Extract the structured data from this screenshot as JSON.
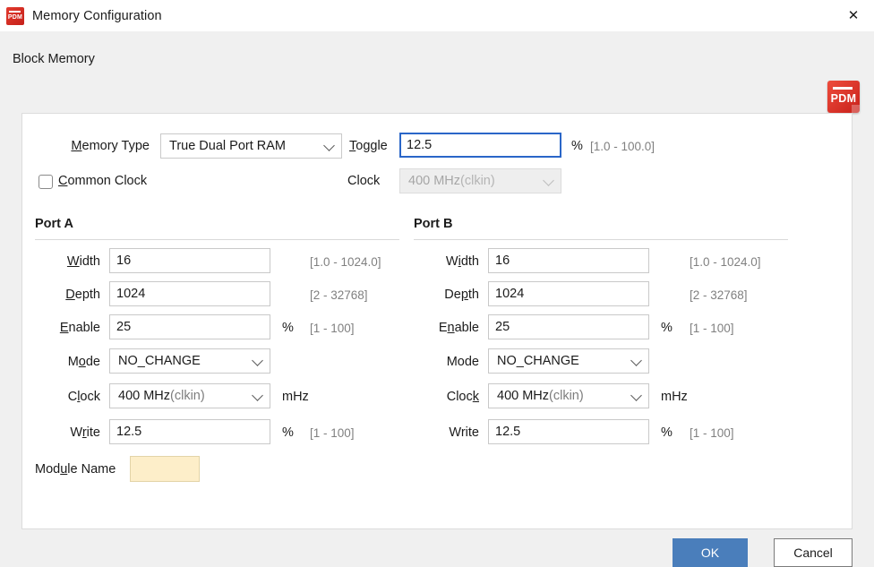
{
  "titlebar": {
    "title": "Memory Configuration",
    "icon_label": "PDM",
    "close_label": "✕"
  },
  "header": {
    "section_title": "Block Memory",
    "logo_label": "PDM"
  },
  "top_form": {
    "memory_type": {
      "label_pre": "",
      "label_accel": "M",
      "label_post": "emory Type",
      "value": "True Dual Port RAM"
    },
    "common_clock": {
      "label_pre": "",
      "label_accel": "C",
      "label_post": "ommon Clock",
      "checked": false
    },
    "toggle": {
      "label_pre": "",
      "label_accel": "T",
      "label_post": "oggle",
      "value": "12.5",
      "unit": "%",
      "range": "[1.0 - 100.0]",
      "focused": true
    },
    "clock": {
      "label": "Clock",
      "value_main": "400 MHz ",
      "value_sub": "(clkin)",
      "disabled": true
    }
  },
  "port_a": {
    "title": "Port A",
    "width": {
      "label_pre": "",
      "label_accel": "W",
      "label_post": "idth",
      "value": "16",
      "unit": "",
      "range": "[1.0 - 1024.0]"
    },
    "depth": {
      "label_pre": "",
      "label_accel": "D",
      "label_post": "epth",
      "value": "1024",
      "unit": "",
      "range": "[2 - 32768]"
    },
    "enable": {
      "label_pre": "",
      "label_accel": "E",
      "label_post": "nable",
      "value": "25",
      "unit": "%",
      "range": "[1 - 100]"
    },
    "mode": {
      "label_pre": "M",
      "label_accel": "o",
      "label_post": "de",
      "value": "NO_CHANGE"
    },
    "clock": {
      "label_pre": "C",
      "label_accel": "l",
      "label_post": "ock",
      "value_main": "400 MHz ",
      "value_sub": "(clkin)",
      "unit": "mHz"
    },
    "write": {
      "label_pre": "W",
      "label_accel": "r",
      "label_post": "ite",
      "value": "12.5",
      "unit": "%",
      "range": "[1 - 100]"
    },
    "module_name": {
      "label_pre": "Mod",
      "label_accel": "u",
      "label_post": "le Name",
      "value": ""
    }
  },
  "port_b": {
    "title": "Port B",
    "width": {
      "label_pre": "W",
      "label_accel": "i",
      "label_post": "dth",
      "value": "16",
      "unit": "",
      "range": "[1.0 - 1024.0]"
    },
    "depth": {
      "label_pre": "De",
      "label_accel": "p",
      "label_post": "th",
      "value": "1024",
      "unit": "",
      "range": "[2 - 32768]"
    },
    "enable": {
      "label_pre": "E",
      "label_accel": "n",
      "label_post": "able",
      "value": "25",
      "unit": "%",
      "range": "[1 - 100]"
    },
    "mode": {
      "label_pre": "Mode",
      "label_accel": "",
      "label_post": "",
      "value": "NO_CHANGE"
    },
    "clock": {
      "label_pre": "Cloc",
      "label_accel": "k",
      "label_post": "",
      "value_main": "400 MHz ",
      "value_sub": "(clkin)",
      "unit": "mHz"
    },
    "write": {
      "label_pre": "Write",
      "label_accel": "",
      "label_post": "",
      "value": "12.5",
      "unit": "%",
      "range": "[1 - 100]"
    }
  },
  "footer": {
    "ok_label": "OK",
    "cancel_label": "Cancel"
  },
  "colors": {
    "accent": "#4a7ebb",
    "brand_red": "#c8201a",
    "focus_border": "#2a66c8",
    "module_field_bg": "#fdeec9",
    "dialog_bg": "#f0f0f0"
  }
}
